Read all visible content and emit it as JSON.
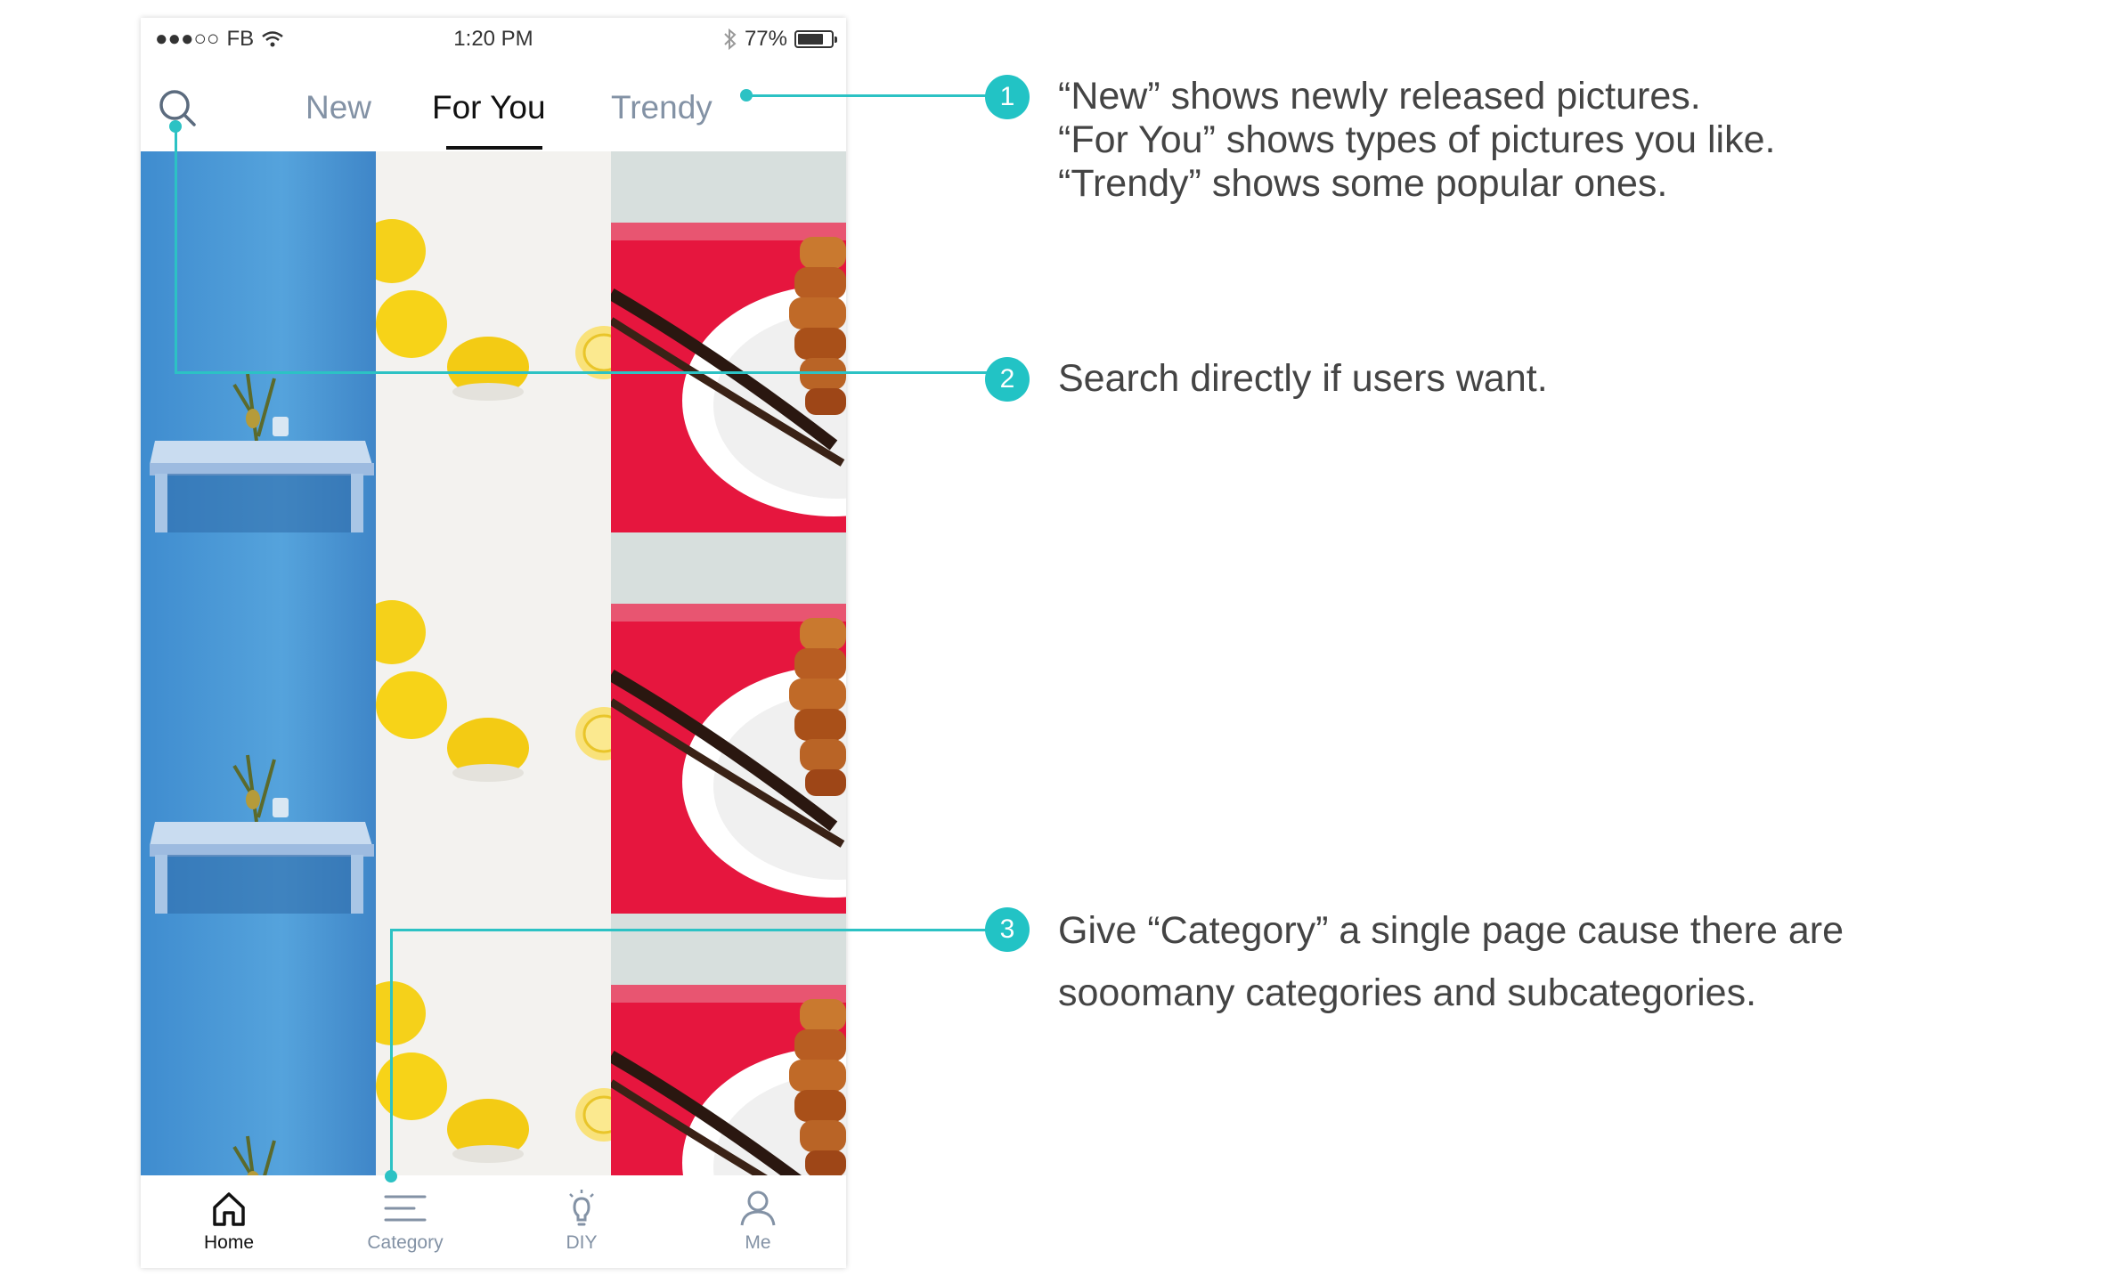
{
  "status_bar": {
    "signal": "●●●○○",
    "carrier": "FB",
    "time": "1:20 PM",
    "battery_percent": "77%",
    "battery_level": 0.77
  },
  "top_nav": {
    "search_icon": "search-icon",
    "tabs": [
      {
        "label": "New",
        "active": false
      },
      {
        "label": "For You",
        "active": true
      },
      {
        "label": "Trendy",
        "active": false
      }
    ]
  },
  "feed": {
    "columns": [
      "blue-wall-table-photo",
      "lemons-photo",
      "cookies-plate-photo"
    ],
    "rows": 3
  },
  "tab_bar": {
    "items": [
      {
        "label": "Home",
        "icon": "home-icon",
        "active": true
      },
      {
        "label": "Category",
        "icon": "menu-lines-icon",
        "active": false
      },
      {
        "label": "DIY",
        "icon": "lightbulb-icon",
        "active": false
      },
      {
        "label": "Me",
        "icon": "user-icon",
        "active": false
      }
    ]
  },
  "annotations": [
    {
      "number": "1",
      "lines": [
        "“New” shows newly released pictures.",
        "“For You” shows types of pictures you like.",
        "“Trendy” shows some popular ones."
      ]
    },
    {
      "number": "2",
      "lines": [
        "Search directly if users want."
      ]
    },
    {
      "number": "3",
      "lines": [
        "Give “Category” a single page cause there are",
        "sooomany categories and subcategories."
      ]
    }
  ],
  "colors": {
    "accent": "#2cc2c4",
    "tab_inactive": "#8392a5",
    "tab_active": "#111111"
  }
}
